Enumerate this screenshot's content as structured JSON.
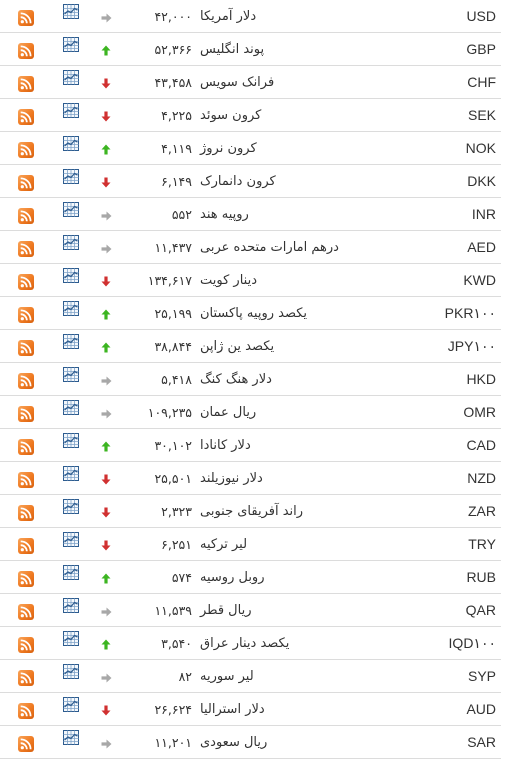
{
  "colors": {
    "up": "#3cb521",
    "down": "#d03030",
    "flat": "#a8a8a8",
    "rss": "#ef7a22",
    "chart": "#2d5c8f",
    "separator": "#dcdcdc",
    "text": "#333333"
  },
  "icons": {
    "rss": "rss-feed-icon",
    "chart": "line-chart-icon",
    "up": "arrow-up-icon",
    "down": "arrow-down-icon",
    "flat": "arrow-right-icon"
  },
  "rows": [
    {
      "code": "USD",
      "name": "دلار آمریکا",
      "price": "۴۲,۰۰۰",
      "trend": "flat"
    },
    {
      "code": "GBP",
      "name": "پوند انگلیس",
      "price": "۵۲,۳۶۶",
      "trend": "up"
    },
    {
      "code": "CHF",
      "name": "فرانک سویس",
      "price": "۴۳,۴۵۸",
      "trend": "down"
    },
    {
      "code": "SEK",
      "name": "کرون سوئد",
      "price": "۴,۲۲۵",
      "trend": "down"
    },
    {
      "code": "NOK",
      "name": "کرون نروژ",
      "price": "۴,۱۱۹",
      "trend": "up"
    },
    {
      "code": "DKK",
      "name": "کرون دانمارک",
      "price": "۶,۱۴۹",
      "trend": "down"
    },
    {
      "code": "INR",
      "name": "روپیه هند",
      "price": "۵۵۲",
      "trend": "flat"
    },
    {
      "code": "AED",
      "name": "درهم امارات متحده عربی",
      "price": "۱۱,۴۳۷",
      "trend": "flat"
    },
    {
      "code": "KWD",
      "name": "دینار کویت",
      "price": "۱۳۴,۶۱۷",
      "trend": "down"
    },
    {
      "code": "PKR۱۰۰",
      "name": "یکصد روپیه پاکستان",
      "price": "۲۵,۱۹۹",
      "trend": "up"
    },
    {
      "code": "JPY۱۰۰",
      "name": "یکصد ین ژاپن",
      "price": "۳۸,۸۴۴",
      "trend": "up"
    },
    {
      "code": "HKD",
      "name": "دلار هنگ کنگ",
      "price": "۵,۴۱۸",
      "trend": "flat"
    },
    {
      "code": "OMR",
      "name": "ریال عمان",
      "price": "۱۰۹,۲۳۵",
      "trend": "flat"
    },
    {
      "code": "CAD",
      "name": "دلار کانادا",
      "price": "۳۰,۱۰۲",
      "trend": "up"
    },
    {
      "code": "NZD",
      "name": "دلار نیوزیلند",
      "price": "۲۵,۵۰۱",
      "trend": "down"
    },
    {
      "code": "ZAR",
      "name": "راند آفریقای جنوبی",
      "price": "۲,۳۲۳",
      "trend": "down"
    },
    {
      "code": "TRY",
      "name": "لیر ترکیه",
      "price": "۶,۲۵۱",
      "trend": "down"
    },
    {
      "code": "RUB",
      "name": "روبل روسیه",
      "price": "۵۷۴",
      "trend": "up"
    },
    {
      "code": "QAR",
      "name": "ریال قطر",
      "price": "۱۱,۵۳۹",
      "trend": "flat"
    },
    {
      "code": "IQD۱۰۰",
      "name": "یکصد دینار عراق",
      "price": "۳,۵۴۰",
      "trend": "up"
    },
    {
      "code": "SYP",
      "name": "لیر سوریه",
      "price": "۸۲",
      "trend": "flat"
    },
    {
      "code": "AUD",
      "name": "دلار استرالیا",
      "price": "۲۶,۶۲۴",
      "trend": "down"
    },
    {
      "code": "SAR",
      "name": "ریال سعودی",
      "price": "۱۱,۲۰۱",
      "trend": "flat"
    }
  ]
}
